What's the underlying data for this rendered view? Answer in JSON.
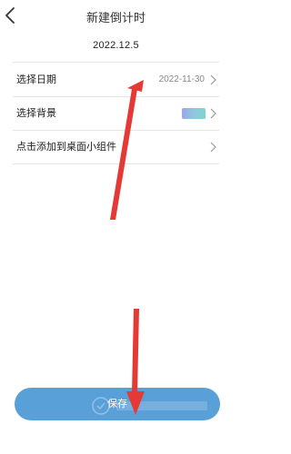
{
  "header": {
    "title": "新建倒计时",
    "back_icon": "back-arrow-icon"
  },
  "name_field": {
    "value": "2022.12.5"
  },
  "rows": [
    {
      "label": "选择日期",
      "value": "2022-11-30"
    },
    {
      "label": "选择背景",
      "swatch_colors": [
        "#9aa7e8",
        "#8fc9de",
        "#7fd4cf"
      ]
    },
    {
      "label": "点击添加到桌面小组件"
    }
  ],
  "save_button": {
    "label": "保存",
    "color": "#5aa0d8"
  },
  "annotation": {
    "color": "#e53935"
  }
}
